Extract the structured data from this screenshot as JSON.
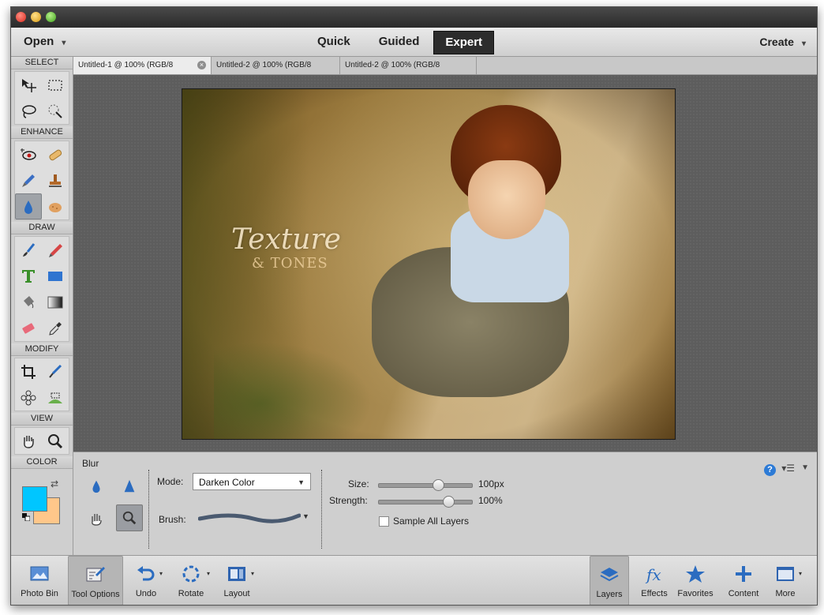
{
  "menubar": {
    "open_label": "Open",
    "modes": [
      "Quick",
      "Guided",
      "Expert"
    ],
    "active_mode": "Expert",
    "create_label": "Create"
  },
  "toolbox": {
    "sections": [
      "SELECT",
      "ENHANCE",
      "DRAW",
      "MODIFY",
      "VIEW",
      "COLOR"
    ],
    "colors": {
      "foreground": "#00c6ff",
      "background": "#ffc78a"
    }
  },
  "tabs": [
    {
      "label": "Untitled-1 @ 100% (RGB/8",
      "active": true
    },
    {
      "label": "Untitled-2 @ 100% (RGB/8",
      "active": false
    },
    {
      "label": "Untitled-2 @ 100% (RGB/8",
      "active": false
    }
  ],
  "photo": {
    "watermark_line1": "Texture",
    "watermark_line2": "& TONES"
  },
  "tool_options": {
    "title": "Blur",
    "mode_label": "Mode:",
    "mode_value": "Darken Color",
    "brush_label": "Brush:",
    "size_label": "Size:",
    "size_value": "100px",
    "size_fraction": 0.63,
    "strength_label": "Strength:",
    "strength_value": "100%",
    "strength_fraction": 0.74,
    "sample_all_layers_label": "Sample All Layers",
    "sample_all_layers_checked": false
  },
  "bottom_left": [
    {
      "label": "Photo Bin",
      "icon": "photo-bin-icon"
    },
    {
      "label": "Tool Options",
      "icon": "tool-options-icon"
    },
    {
      "label": "Undo",
      "icon": "undo-icon"
    },
    {
      "label": "Rotate",
      "icon": "rotate-icon"
    },
    {
      "label": "Layout",
      "icon": "layout-icon"
    }
  ],
  "bottom_right": [
    {
      "label": "Layers",
      "icon": "layers-icon"
    },
    {
      "label": "Effects",
      "icon": "effects-icon"
    },
    {
      "label": "Favorites",
      "icon": "favorites-icon"
    },
    {
      "label": "Content",
      "icon": "content-icon"
    },
    {
      "label": "More",
      "icon": "more-icon"
    }
  ]
}
